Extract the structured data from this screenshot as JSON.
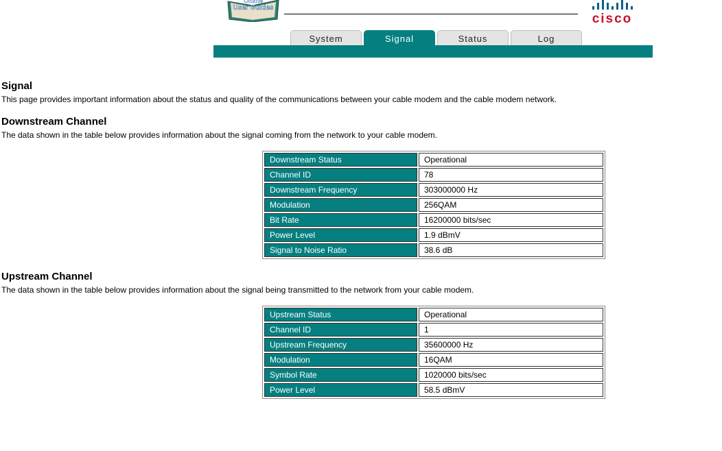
{
  "header": {
    "logo_text": "Online User Guides",
    "brand": "cisco"
  },
  "tabs": [
    {
      "label": "System"
    },
    {
      "label": "Signal",
      "active": true
    },
    {
      "label": "Status"
    },
    {
      "label": "Log"
    }
  ],
  "colors": {
    "accent": "#067f80",
    "brand_red": "#c8102e"
  },
  "page": {
    "title": "Signal",
    "description": "This page provides important information about the status and quality of the communications between your cable modem and the cable modem network."
  },
  "downstream": {
    "title": "Downstream Channel",
    "description": "The data shown in the table below provides information about the signal coming from the network to your cable modem.",
    "rows": [
      {
        "label": "Downstream Status",
        "value": "Operational"
      },
      {
        "label": "Channel ID",
        "value": "78"
      },
      {
        "label": "Downstream Frequency",
        "value": "303000000 Hz"
      },
      {
        "label": "Modulation",
        "value": "256QAM"
      },
      {
        "label": "Bit Rate",
        "value": "16200000 bits/sec"
      },
      {
        "label": "Power Level",
        "value": "1.9 dBmV"
      },
      {
        "label": "Signal to Noise Ratio",
        "value": "38.6 dB"
      }
    ]
  },
  "upstream": {
    "title": "Upstream Channel",
    "description": "The data shown in the table below provides information about the signal being transmitted to the network from your cable modem.",
    "rows": [
      {
        "label": "Upstream Status",
        "value": "Operational"
      },
      {
        "label": "Channel ID",
        "value": "1"
      },
      {
        "label": "Upstream Frequency",
        "value": "35600000 Hz"
      },
      {
        "label": "Modulation",
        "value": "16QAM"
      },
      {
        "label": "Symbol Rate",
        "value": "1020000 bits/sec"
      },
      {
        "label": "Power Level",
        "value": "58.5 dBmV"
      }
    ]
  }
}
